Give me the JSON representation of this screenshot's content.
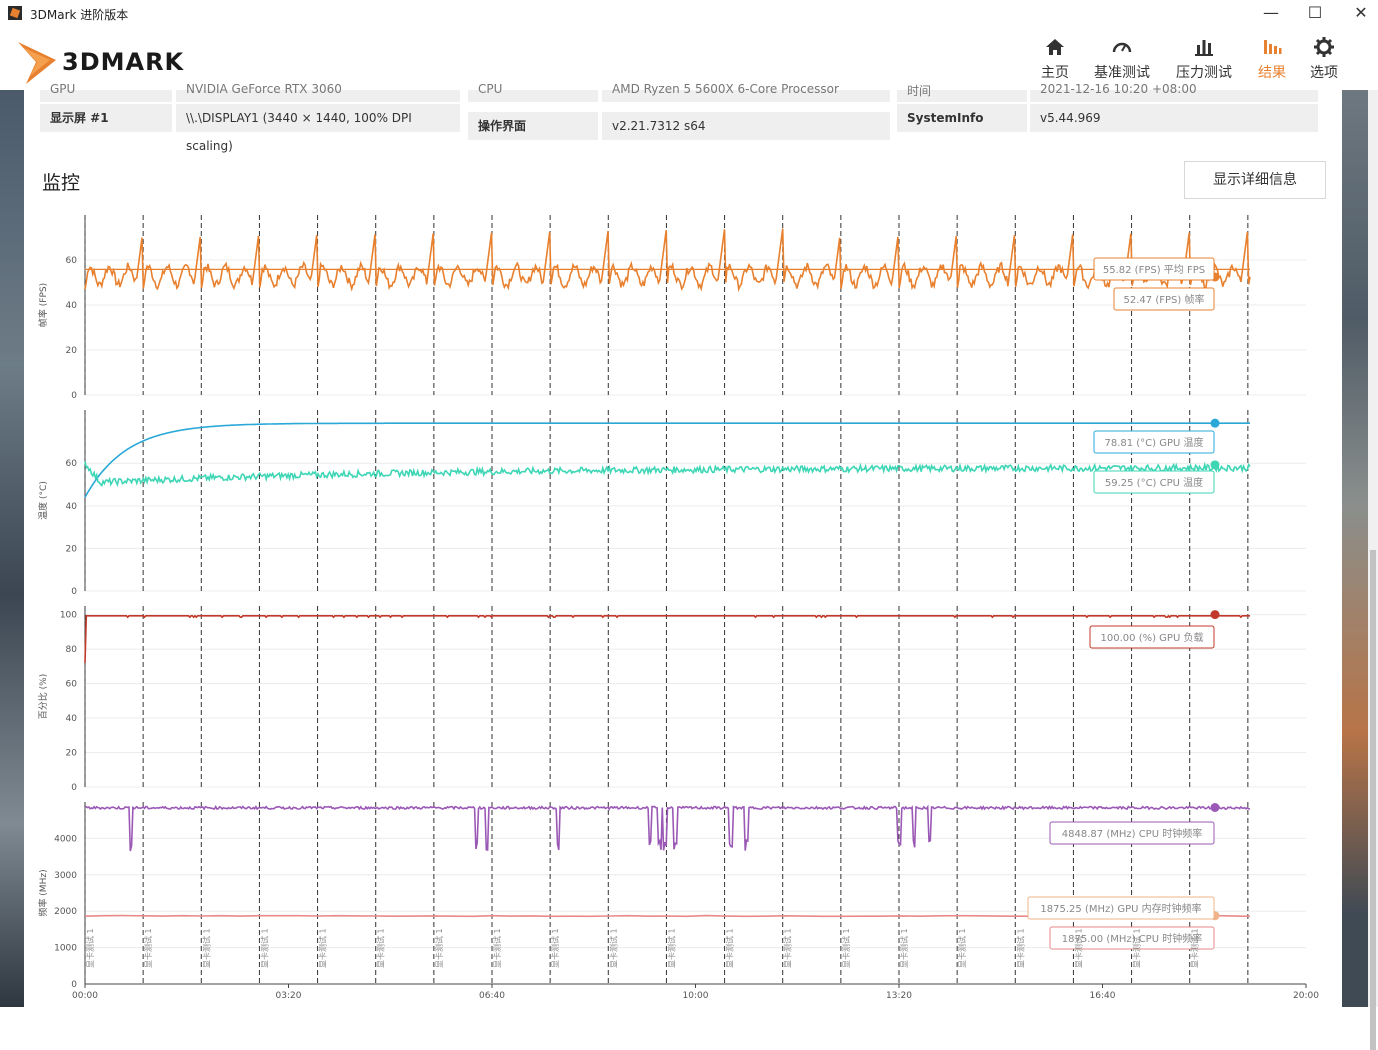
{
  "window": {
    "title": "3DMark 进阶版本",
    "controls": [
      "—",
      "☐",
      "✕"
    ]
  },
  "logo": {
    "text": "3DMARK"
  },
  "nav": [
    {
      "label": "主页",
      "icon": "home-icon"
    },
    {
      "label": "基准测试",
      "icon": "speedometer-icon"
    },
    {
      "label": "压力测试",
      "icon": "bar-chart-icon"
    },
    {
      "label": "结果",
      "icon": "results-icon",
      "active": true
    },
    {
      "label": "选项",
      "icon": "gear-icon"
    }
  ],
  "colors": {
    "accent": "#e8812f",
    "fps": "#e8812f",
    "gpu_temp": "#2aa8d8",
    "cpu_temp": "#3fd6b6",
    "gpu_load": "#c0392b",
    "cpu_clock": "#9b59b6",
    "gpu_mem_clock": "#f0b38a",
    "cpu_clock2": "#e88a8a"
  },
  "sysinfo": {
    "cut_row": [
      "GPU",
      "NVIDIA GeForce RTX 3060",
      "CPU",
      "AMD Ryzen 5 5600X 6-Core Processor",
      "时间",
      "2021-12-16 10:20 +08:00"
    ],
    "display_label": "显示屏 #1",
    "display_value": "\\\\.\\DISPLAY1 (3440 × 1440, 100% DPI scaling)",
    "ui_label": "操作界面",
    "ui_value": "v2.21.7312 s64",
    "si_label": "SystemInfo",
    "si_value": "v5.44.969"
  },
  "monitor": {
    "title": "监控",
    "detail_button": "显示详细信息"
  },
  "chart_data": [
    {
      "type": "line",
      "ylabel": "帧率 (FPS)",
      "yticks": [
        0,
        20,
        40,
        60
      ],
      "ylim": [
        0,
        80
      ],
      "series": [
        {
          "name": "帧率",
          "unit": "FPS",
          "typical": 55,
          "last": 52.47
        }
      ],
      "average": 55.82,
      "labels": [
        "55.82 (FPS) 平均 FPS",
        "52.47 (FPS) 帧率"
      ]
    },
    {
      "type": "line",
      "ylabel": "温度 (°C)",
      "yticks": [
        0,
        20,
        40,
        60
      ],
      "ylim": [
        0,
        85
      ],
      "series": [
        {
          "name": "GPU 温度",
          "start": 44,
          "plateau": 78.8,
          "last": 78.81
        },
        {
          "name": "CPU 温度",
          "start": 60,
          "range": [
            49,
            60
          ],
          "last": 59.25
        }
      ],
      "labels": [
        "78.81 (°C) GPU 温度",
        "59.25 (°C) CPU 温度"
      ]
    },
    {
      "type": "line",
      "ylabel": "百分比 (%)",
      "yticks": [
        0,
        20,
        40,
        60,
        80,
        100
      ],
      "ylim": [
        0,
        105
      ],
      "series": [
        {
          "name": "GPU 负载",
          "start": 72,
          "plateau": 99.5,
          "last": 100.0
        }
      ],
      "labels": [
        "100.00 (%) GPU 负载"
      ]
    },
    {
      "type": "line",
      "ylabel": "频率 (MHz)",
      "yticks": [
        0,
        1000,
        2000,
        3000,
        4000
      ],
      "ylim": [
        0,
        5000
      ],
      "series": [
        {
          "name": "CPU 时钟频率",
          "typical": 4850,
          "min": 3650,
          "last": 4848.87
        },
        {
          "name": "GPU 内存时钟频率",
          "typical": 1875,
          "last": 1875.25
        },
        {
          "name": "CPU 时钟频率",
          "typical": 1875,
          "last": 1875.0
        }
      ],
      "labels": [
        "4848.87 (MHz) CPU 时钟频率",
        "1875.25 (MHz) GPU 内存时钟频率",
        "1875.00 (MHz) CPU 时钟频率"
      ]
    }
  ],
  "x_axis": {
    "ticks": [
      "00:00",
      "03:20",
      "06:40",
      "10:00",
      "13:20",
      "16:40",
      "20:00"
    ],
    "range_seconds": [
      0,
      1200
    ]
  },
  "loop_label": "显卡测试 1",
  "loop_count": 20
}
